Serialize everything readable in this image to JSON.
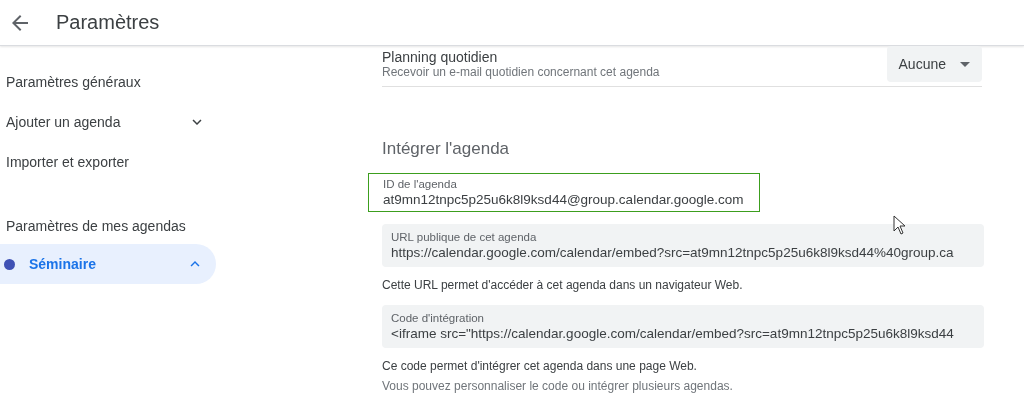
{
  "header": {
    "title": "Paramètres"
  },
  "sidebar": {
    "items": [
      {
        "label": "Paramètres généraux",
        "kind": "link",
        "selected": false
      },
      {
        "label": "Ajouter un agenda",
        "kind": "expandable",
        "expanded": false,
        "selected": false
      },
      {
        "label": "Importer et exporter",
        "kind": "link",
        "selected": false
      },
      {
        "label": "Paramètres de mes agendas",
        "kind": "heading"
      },
      {
        "label": "Séminaire",
        "kind": "calendar",
        "color": "#3f51b5",
        "expanded": true,
        "selected": true
      }
    ]
  },
  "daily_agenda": {
    "title": "Planning quotidien",
    "description": "Recevoir un e-mail quotidien concernant cet agenda",
    "value": "Aucune"
  },
  "embed_section": {
    "title": "Intégrer l'agenda",
    "fields": [
      {
        "label": "ID de l'agenda",
        "value": "at9mn12tnpc5p25u6k8l9ksd44@group.calendar.google.com",
        "focused": true
      },
      {
        "label": "URL publique de cet agenda",
        "value": "https://calendar.google.com/calendar/embed?src=at9mn12tnpc5p25u6k8l9ksd44%40group.ca",
        "focused": false,
        "help": [
          "Cette URL permet d'accéder à cet agenda dans un navigateur Web."
        ]
      },
      {
        "label": "Code d'intégration",
        "value": "<iframe src=\"https://calendar.google.com/calendar/embed?src=at9mn12tnpc5p25u6k8l9ksd44",
        "focused": false,
        "help": [
          "Ce code permet d'intégrer cet agenda dans une page Web.",
          "Vous pouvez personnaliser le code ou intégrer plusieurs agendas."
        ]
      }
    ]
  }
}
